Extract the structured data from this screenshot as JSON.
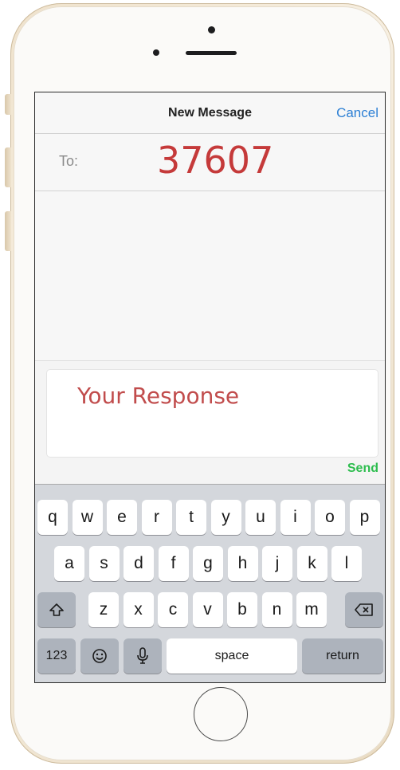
{
  "header": {
    "title": "New Message",
    "cancel_label": "Cancel"
  },
  "recipient": {
    "label": "To:",
    "value": "37607"
  },
  "compose": {
    "text": "Your Response",
    "send_label": "Send"
  },
  "keyboard": {
    "row1": [
      "q",
      "w",
      "e",
      "r",
      "t",
      "y",
      "u",
      "i",
      "o",
      "p"
    ],
    "row2": [
      "a",
      "s",
      "d",
      "f",
      "g",
      "h",
      "j",
      "k",
      "l"
    ],
    "row3": [
      "z",
      "x",
      "c",
      "v",
      "b",
      "n",
      "m"
    ],
    "numbers_label": "123",
    "space_label": "space",
    "return_label": "return",
    "shift_icon": "shift-icon",
    "backspace_icon": "backspace-icon",
    "emoji_icon": "emoji-icon",
    "mic_icon": "microphone-icon"
  },
  "colors": {
    "accent_blue": "#2c7fd4",
    "send_green": "#2dbd4e",
    "highlight_red": "#c53a3a"
  }
}
